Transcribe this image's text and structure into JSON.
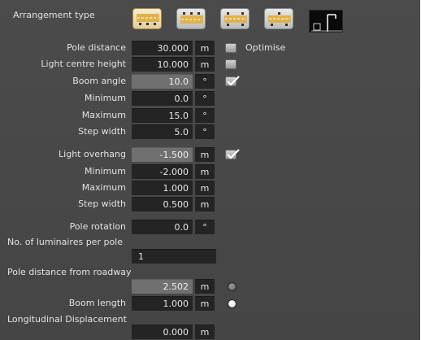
{
  "arrangement": {
    "label": "Arrangement type",
    "options": [
      {
        "name": "single-sided-bottom",
        "icon": "arrangement-single-bottom-icon",
        "active": true
      },
      {
        "name": "single-sided-top",
        "icon": "arrangement-single-top-icon",
        "active": false
      },
      {
        "name": "double-sided-opposite",
        "icon": "arrangement-double-opposite-icon",
        "active": false
      },
      {
        "name": "double-sided-staggered",
        "icon": "arrangement-double-staggered-icon",
        "active": false
      }
    ],
    "pole_icon": "street-lamp-pole-icon"
  },
  "pole_distance": {
    "label": "Pole distance",
    "value": "30.000",
    "unit": "m",
    "optimise_label": "Optimise",
    "optimise_checked": false
  },
  "light_centre_height": {
    "label": "Light centre height",
    "value": "10.000",
    "unit": "m",
    "checked": false
  },
  "boom_angle": {
    "label": "Boom angle",
    "value": "10.0",
    "unit": "°",
    "checked": true,
    "minimum": {
      "label": "Minimum",
      "value": "0.0",
      "unit": "°"
    },
    "maximum": {
      "label": "Maximum",
      "value": "15.0",
      "unit": "°"
    },
    "step_width": {
      "label": "Step width",
      "value": "5.0",
      "unit": "°"
    }
  },
  "light_overhang": {
    "label": "Light overhang",
    "value": "-1.500",
    "unit": "m",
    "checked": true,
    "minimum": {
      "label": "Minimum",
      "value": "-2.000",
      "unit": "m"
    },
    "maximum": {
      "label": "Maximum",
      "value": "1.000",
      "unit": "m"
    },
    "step_width": {
      "label": "Step width",
      "value": "0.500",
      "unit": "m"
    }
  },
  "pole_rotation": {
    "label": "Pole rotation",
    "value": "0.0",
    "unit": "°"
  },
  "luminaires_per_pole": {
    "label": "No. of luminaires per pole",
    "value": "1"
  },
  "pole_distance_roadway": {
    "label": "Pole distance from roadway",
    "value": "2.502",
    "unit": "m",
    "radio_selected": false
  },
  "boom_length": {
    "label": "Boom length",
    "value": "1.000",
    "unit": "m",
    "radio_selected": true
  },
  "longitudinal_displacement": {
    "label": "Longitudinal Displacement",
    "value": "0.000",
    "unit": "m"
  },
  "colors": {
    "panel_bg": "#474747",
    "field_bg": "#242424",
    "field_light_bg": "#707070",
    "active_button": "#e4cf9c"
  }
}
